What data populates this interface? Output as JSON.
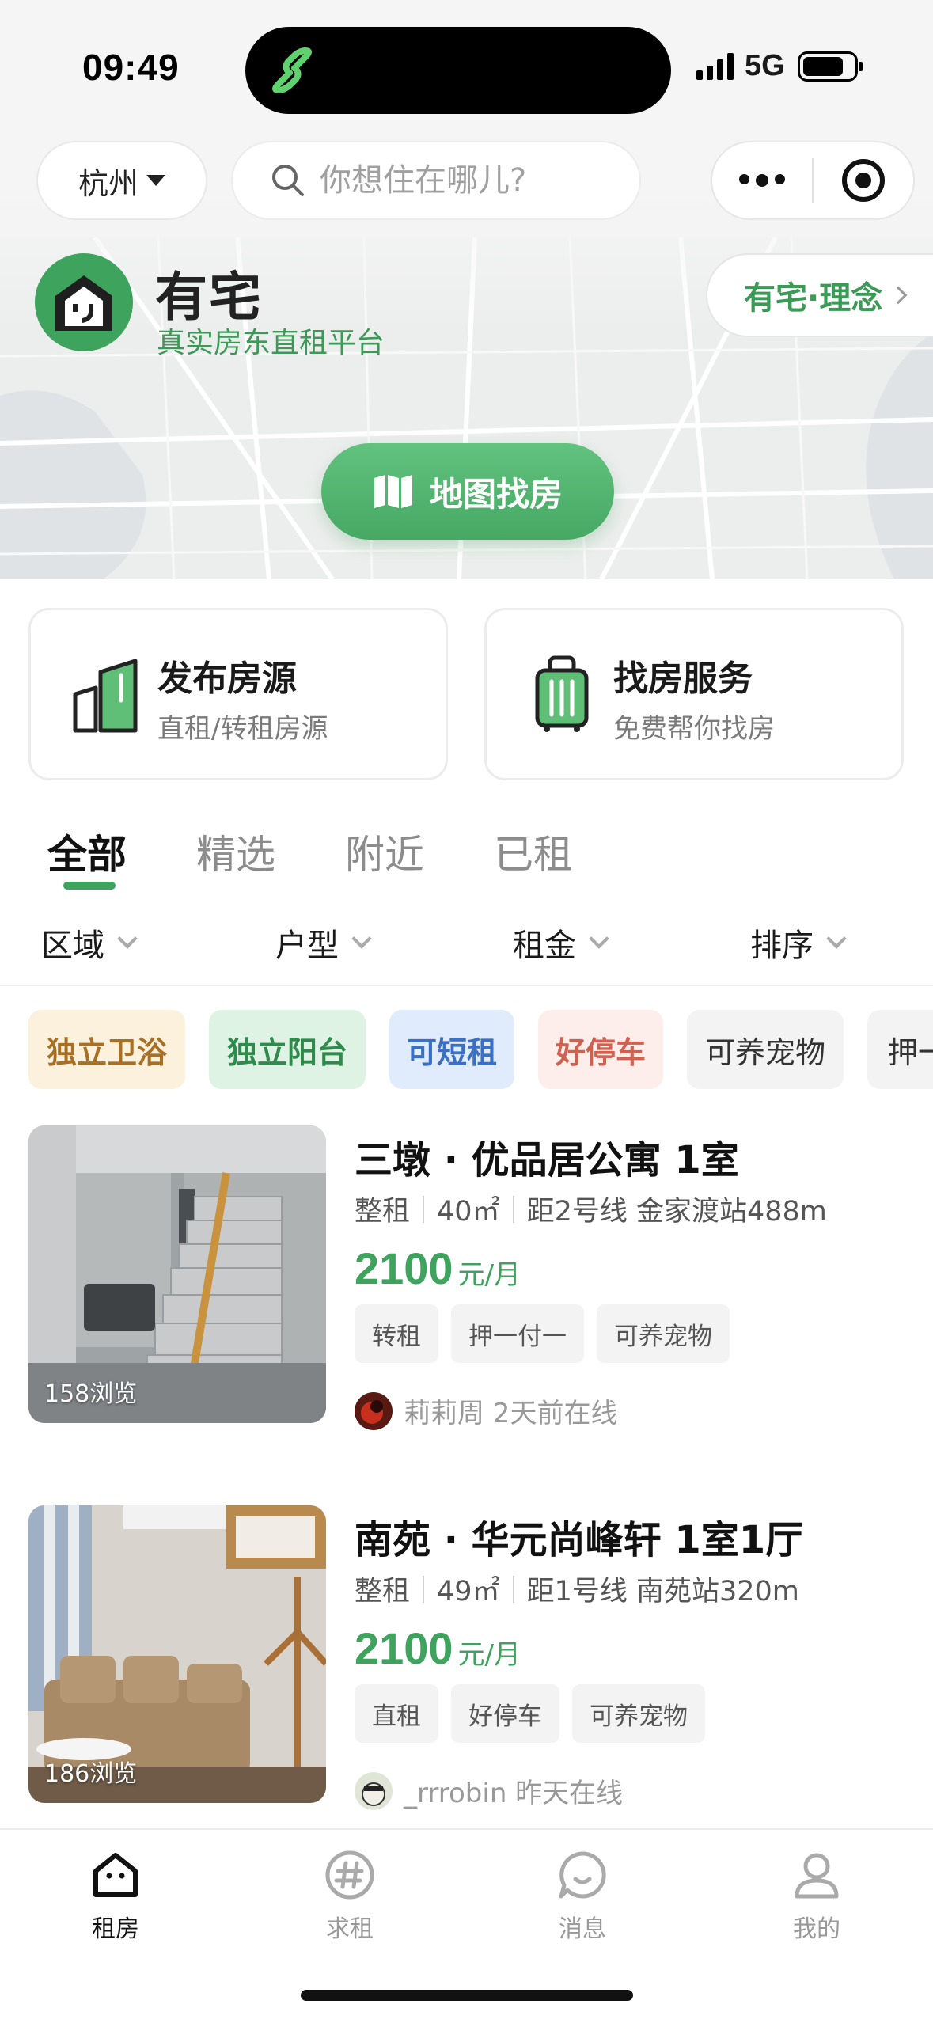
{
  "status_bar": {
    "time": "09:49",
    "network": "5G"
  },
  "header": {
    "city": "杭州",
    "search_placeholder": "你想住在哪儿?"
  },
  "brand": {
    "name": "有宅",
    "slogan": "真实房东直租平台",
    "concept_label": "有宅·理念",
    "map_button_label": "地图找房"
  },
  "services": [
    {
      "title": "发布房源",
      "subtitle": "直租/转租房源"
    },
    {
      "title": "找房服务",
      "subtitle": "免费帮你找房"
    }
  ],
  "tabs": [
    {
      "label": "全部",
      "active": true
    },
    {
      "label": "精选",
      "active": false
    },
    {
      "label": "附近",
      "active": false
    },
    {
      "label": "已租",
      "active": false
    }
  ],
  "filters": [
    "区域",
    "户型",
    "租金",
    "排序"
  ],
  "chips": [
    {
      "label": "独立卫浴",
      "bg": "#fbf1dc",
      "color": "#a87024"
    },
    {
      "label": "独立阳台",
      "bg": "#def3e4",
      "color": "#2f8a4c"
    },
    {
      "label": "可短租",
      "bg": "#e0ebfb",
      "color": "#3a6fc4"
    },
    {
      "label": "好停车",
      "bg": "#fdeeec",
      "color": "#d0604f"
    },
    {
      "label": "可养宠物",
      "bg": "#f3f3f3",
      "color": "#333333"
    },
    {
      "label": "押一",
      "bg": "#f3f3f3",
      "color": "#333333"
    }
  ],
  "listings": [
    {
      "title": "三墩 · 优品居公寓 1室",
      "type": "整租",
      "area": "40㎡",
      "distance": "距2号线 金家渡站488m",
      "price": "2100",
      "price_unit": "元/月",
      "tags": [
        "转租",
        "押一付一",
        "可养宠物"
      ],
      "views": "158浏览",
      "owner": "莉莉周 2天前在线"
    },
    {
      "title": "南苑 · 华元尚峰轩 1室1厅",
      "type": "整租",
      "area": "49㎡",
      "distance": "距1号线 南苑站320m",
      "price": "2100",
      "price_unit": "元/月",
      "tags": [
        "直租",
        "好停车",
        "可养宠物"
      ],
      "views": "186浏览",
      "owner": "_rrrobin 昨天在线"
    }
  ],
  "tabbar": [
    {
      "label": "租房",
      "icon": "house-icon",
      "active": true
    },
    {
      "label": "求租",
      "icon": "hashtag-icon",
      "active": false
    },
    {
      "label": "消息",
      "icon": "chat-bubble-icon",
      "active": false
    },
    {
      "label": "我的",
      "icon": "person-icon",
      "active": false
    }
  ],
  "colors": {
    "brand_green": "#3da35d",
    "price_green": "#3da35d"
  }
}
